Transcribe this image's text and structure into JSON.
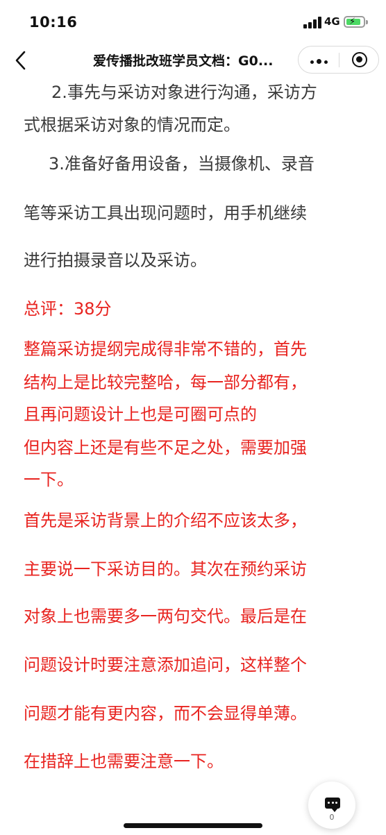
{
  "status_bar": {
    "time": "10:16",
    "network": "4G"
  },
  "nav": {
    "title": "爱传播批改班学员文档：G0..."
  },
  "article": {
    "paragraphs": [
      {
        "text": "2.事先与采访对象进行沟通，采访方",
        "color": "#3a3a3a"
      },
      {
        "text": "式根据采访对象的情况而定。",
        "color": "#3a3a3a"
      },
      {
        "text": "3.准备好备用设备，当摄像机、录音",
        "color": "#3a3a3a"
      },
      {
        "text": "笔等采访工具出现问题时，用手机继续",
        "color": "#3a3a3a"
      },
      {
        "text": "进行拍摄录音以及采访。",
        "color": "#3a3a3a"
      },
      {
        "text": "总评：38分",
        "color": "#e8231f"
      },
      {
        "text": "整篇采访提纲完成得非常不错的，首先",
        "color": "#e8231f"
      },
      {
        "text": "结构上是比较完整哈，每一部分都有，",
        "color": "#e8231f"
      },
      {
        "text": "且再问题设计上也是可圈可点的",
        "color": "#e8231f"
      },
      {
        "text": "但内容上还是有些不足之处，需要加强",
        "color": "#e8231f"
      },
      {
        "text": "一下。",
        "color": "#e8231f"
      },
      {
        "text": "首先是采访背景上的介绍不应该太多，",
        "color": "#e8231f"
      },
      {
        "text": "主要说一下采访目的。其次在预约采访",
        "color": "#e8231f"
      },
      {
        "text": "对象上也需要多一两句交代。最后是在",
        "color": "#e8231f"
      },
      {
        "text": "问题设计时要注意添加追问，这样整个",
        "color": "#e8231f"
      },
      {
        "text": "问题才能有更内容，而不会显得单薄。",
        "color": "#e8231f"
      },
      {
        "text": "在措辞上也需要注意一下。",
        "color": "#e8231f"
      }
    ]
  },
  "comment": {
    "count": "0",
    "icon": "comment-icon"
  },
  "icons": {
    "back": "chevron-left-icon",
    "more": "more-dots-icon",
    "close": "mini-program-close-icon"
  }
}
